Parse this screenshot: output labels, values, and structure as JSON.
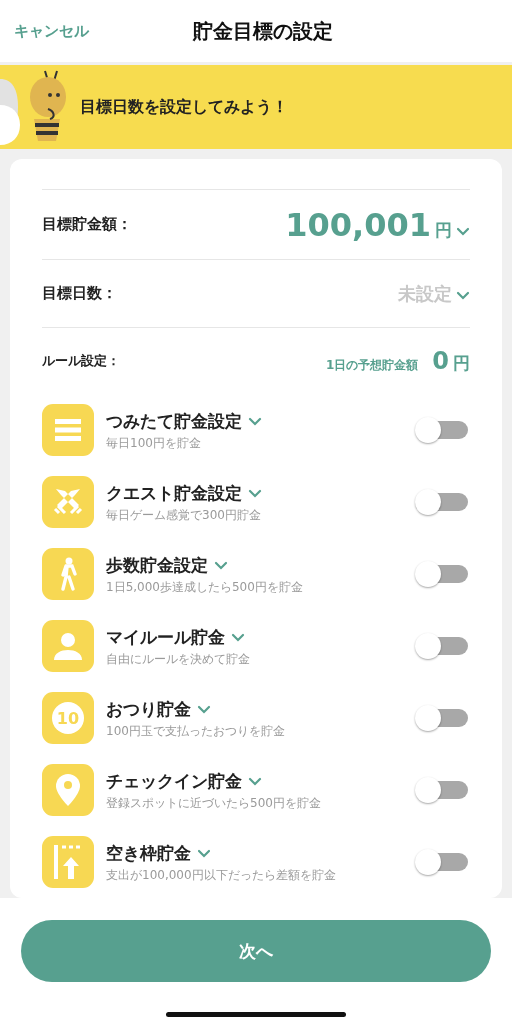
{
  "header": {
    "cancel": "キャンセル",
    "title": "貯金目標の設定"
  },
  "banner": {
    "message": "目標日数を設定してみよう！"
  },
  "goal_amount": {
    "label": "目標貯金額：",
    "value": "100,001",
    "unit": "円"
  },
  "goal_days": {
    "label": "目標日数：",
    "value": "未設定",
    "unset": true
  },
  "rules_header": {
    "label": "ルール設定：",
    "daily_label": "1日の予想貯金額",
    "daily_value": "0",
    "daily_unit": "円"
  },
  "rules": [
    {
      "kind": "list",
      "title": "つみたて貯金設定",
      "description": "毎日100円を貯金",
      "on": false
    },
    {
      "kind": "swords",
      "title": "クエスト貯金設定",
      "description": "毎日ゲーム感覚で300円貯金",
      "on": false
    },
    {
      "kind": "walk",
      "title": "歩数貯金設定",
      "description": "1日5,000歩達成したら500円を貯金",
      "on": false
    },
    {
      "kind": "person",
      "title": "マイルール貯金",
      "description": "自由にルールを決めて貯金",
      "on": false
    },
    {
      "kind": "coin",
      "coin_label": "10",
      "title": "おつり貯金",
      "description": "100円玉で支払ったおつりを貯金",
      "on": false
    },
    {
      "kind": "pin",
      "title": "チェックイン貯金",
      "description": "登録スポットに近づいたら500円を貯金",
      "on": false
    },
    {
      "kind": "upload",
      "title": "空き枠貯金",
      "description": "支出が100,000円以下だったら差額を貯金",
      "on": false
    }
  ],
  "next_button": "次へ"
}
